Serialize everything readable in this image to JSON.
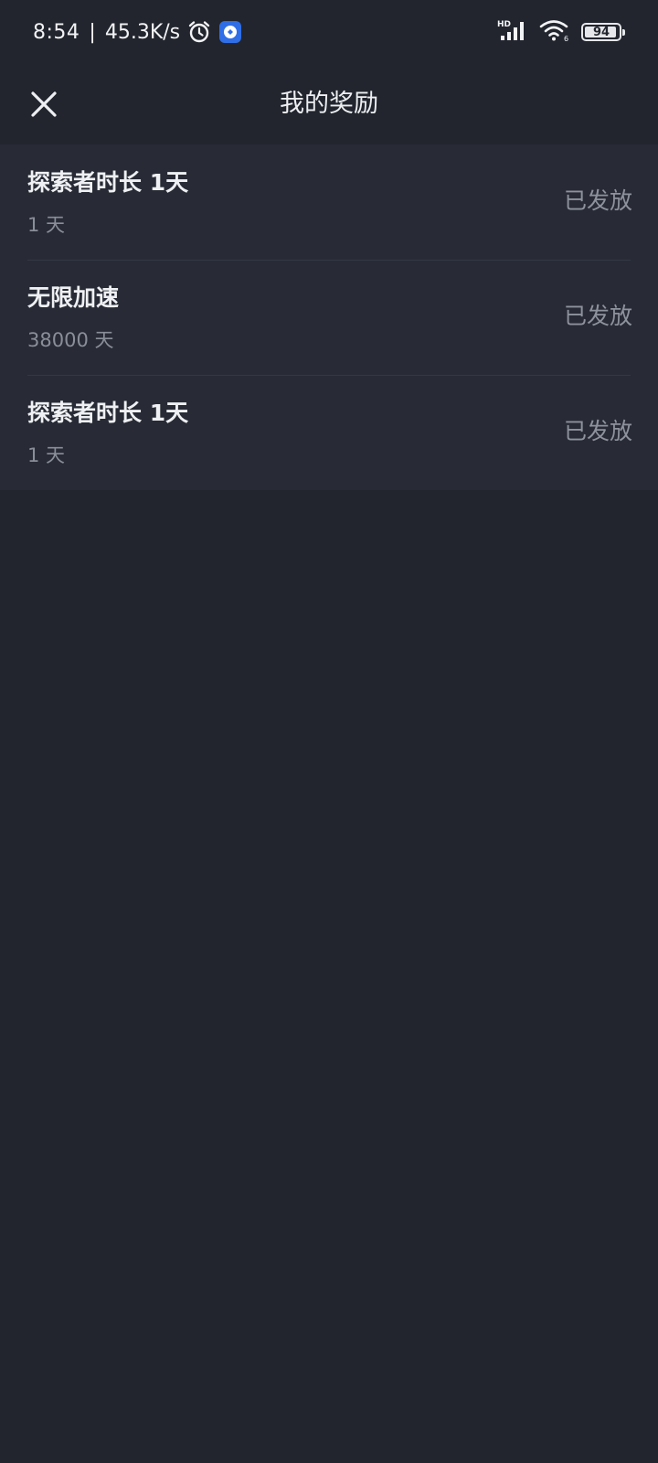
{
  "status_bar": {
    "time": "8:54",
    "separator": "|",
    "net_speed": "45.3K/s",
    "signal_label": "HD",
    "wifi_label": "6",
    "battery_level": "94",
    "icons": [
      "alarm-icon",
      "app-notification-icon",
      "signal-icon",
      "wifi-icon",
      "battery-icon"
    ]
  },
  "header": {
    "title": "我的奖励",
    "close_icon": "close-icon"
  },
  "rewards": [
    {
      "name": "探索者时长 1天",
      "duration": "1 天",
      "status": "已发放"
    },
    {
      "name": "无限加速",
      "duration": "38000 天",
      "status": "已发放"
    },
    {
      "name": "探索者时长 1天",
      "duration": "1 天",
      "status": "已发放"
    }
  ],
  "colors": {
    "background": "#22252e",
    "card": "#282b35",
    "divider": "#343844",
    "primary_text": "#eef0f3",
    "secondary_text": "#8a8e99",
    "status_text": "#8e929c",
    "app_icon_blue": "#2f6ee6"
  }
}
